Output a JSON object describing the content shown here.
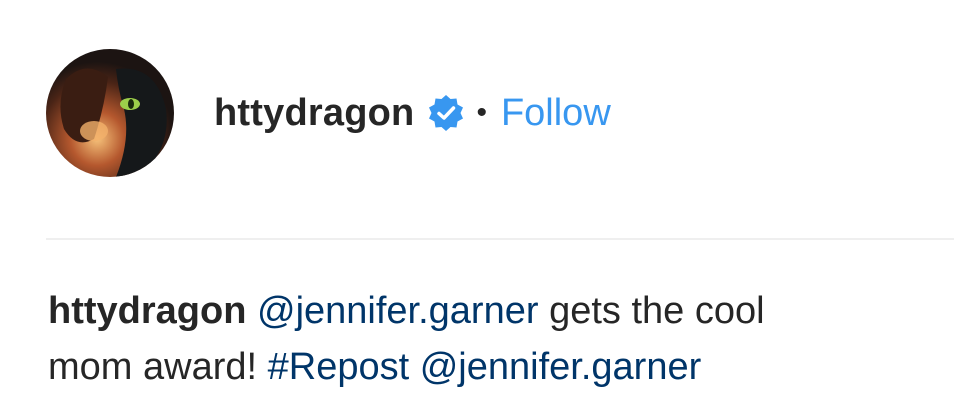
{
  "post": {
    "username": "httydragon",
    "verified_icon": "verified-badge-icon",
    "separator": "•",
    "follow_label": "Follow"
  },
  "caption": {
    "username": "httydragon",
    "mention_1": "@jennifer.garner",
    "text_1": "gets the cool",
    "text_2": "mom award!",
    "hashtag": "#Repost",
    "mention_2": "@jennifer.garner"
  },
  "colors": {
    "link_blue": "#3897f0",
    "mention_navy": "#003569",
    "text": "#262626",
    "divider": "#efefef"
  }
}
